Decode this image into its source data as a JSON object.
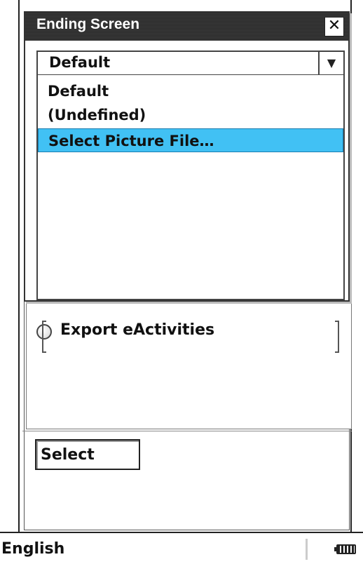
{
  "dialog": {
    "title": "Ending Screen",
    "close_icon": "close-icon",
    "close_glyph": "✕",
    "combo_value": "Default",
    "combo_arrow_glyph": "▼",
    "dropdown_items": [
      {
        "label": "Default",
        "selected": false
      },
      {
        "label": "(Undefined)",
        "selected": false
      },
      {
        "label": "Select Picture File…",
        "selected": true
      }
    ]
  },
  "background": {
    "fragment_1": "J",
    "fragment_2": "S",
    "radio_label": "Export eActivities",
    "select_button": "Select"
  },
  "statusbar": {
    "language": "English",
    "battery_icon": "battery-icon"
  },
  "colors": {
    "selection": "#41c1f4",
    "titlebar": "#2f2f2f"
  }
}
